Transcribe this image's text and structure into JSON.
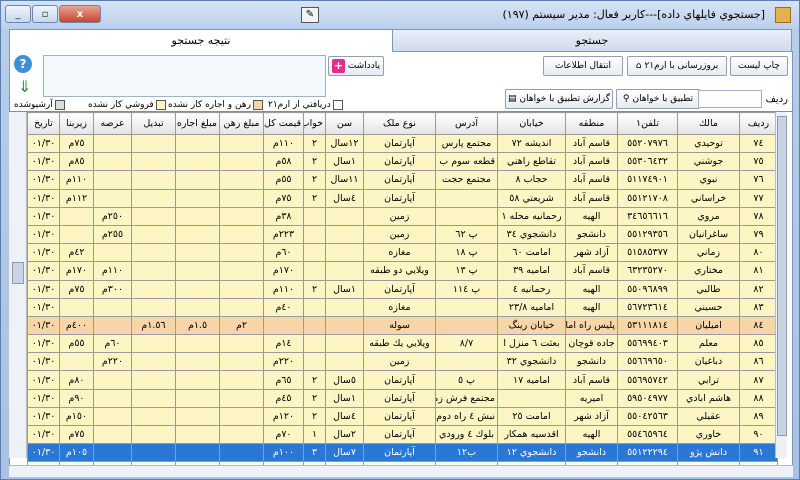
{
  "window": {
    "title": "[جستجوي فايلهاي داده]---كاربر فعال: مدير سيستم (١٩٧)",
    "buttons": {
      "minimize": "_",
      "maximize": "▫",
      "close": "x"
    }
  },
  "tabs": [
    {
      "label": "جستجو",
      "active": false
    },
    {
      "label": "نتيجه جستجو",
      "active": true
    }
  ],
  "toolbar": {
    "print_label": "چاپ ليست",
    "sms_label": "بروزرسانی با ارم٢١",
    "transfer_label": "انتقال اطلاعات",
    "note_label": "يادداشت",
    "match_label": "تطبيق با خواهان",
    "report_label": "گزارش تطبيق با خواهان",
    "row_search_label": "رديف",
    "row_search_value": ""
  },
  "legend": [
    {
      "label": "دريافتي از ارم٢١",
      "color": "#ffffff"
    },
    {
      "label": "رهن و اجاره كار نشده",
      "color": "#f6d6a8"
    },
    {
      "label": "فروشي كار نشده",
      "color": "#fdf6c4"
    },
    {
      "label": "آرشيوشده",
      "color": "#dcdcdc"
    }
  ],
  "colors": {
    "selected": "#2b77d6",
    "yellow_row": "#fdf6c4",
    "orange_row": "#f6d6a8"
  },
  "columns": [
    "رديف",
    "مالك",
    "تلفن١",
    "منطقه",
    "خيابان",
    "آدرس",
    "نوع ملک",
    "سن",
    "خواب",
    "قيمت كل",
    "مبلغ رهن",
    "مبلغ اجاره",
    "تبديل",
    "عرصه",
    "زيربنا",
    "تاريخ"
  ],
  "rows": [
    {
      "cls": "r-y",
      "cells": [
        "٧٤",
        "توحيدي",
        "٥٥٢٠٧٩٧٦",
        "قاسم آباد",
        "انديشه ٧٢",
        "مجتمع پارس",
        "آپارتمان",
        "١٢سال",
        "٢",
        "١١٠م",
        "",
        "",
        "",
        "",
        "٧٥م",
        "٠١/٣٠"
      ]
    },
    {
      "cls": "r-y",
      "cells": [
        "٧٥",
        "جوشني",
        "٥٥٣٠٦٤٣٢",
        "قاسم آباد",
        "تقاطع راهني",
        "قطعه سوم ب ٤٣",
        "آپارتمان",
        "١سال",
        "٢",
        "٥٨م",
        "",
        "",
        "",
        "",
        "٨٥م",
        "٠١/٣٠"
      ]
    },
    {
      "cls": "r-y",
      "cells": [
        "٧٦",
        "نبوي",
        "٥١١٧٤٩٠١",
        "قاسم آباد",
        "حجاب ٨",
        "مجتمع حجت",
        "آپارتمان",
        "١١سال",
        "٢",
        "٥٥م",
        "",
        "",
        "",
        "",
        "١١٠م",
        "٠١/٣٠"
      ]
    },
    {
      "cls": "r-y",
      "cells": [
        "٧٧",
        "خراساني",
        "٥٥١٢١٧٠٨",
        "قاسم آباد",
        "شريعتي ٥٨",
        "",
        "آپارتمان",
        "٤سال",
        "٢",
        "٧٥م",
        "",
        "",
        "",
        "",
        "١١٢م",
        "٠١/٣٠"
      ]
    },
    {
      "cls": "r-y",
      "cells": [
        "٧٨",
        "مروي",
        "٣٤٦٥٦٦١٦",
        "الهيه",
        "رحمانيه محله ١",
        "",
        "زمين",
        "",
        "",
        "٣٨م",
        "",
        "",
        "",
        "٢٥٠م",
        "",
        "٠١/٣٠"
      ]
    },
    {
      "cls": "r-y",
      "cells": [
        "٧٩",
        "ساغرانيان",
        "٥٥١٢٩٣٥٦",
        "دانشجو",
        "دانشجوي ٣٤",
        "پ ٦٢",
        "زمين",
        "",
        "",
        "٢٢٣م",
        "",
        "",
        "",
        "٢٥٥م",
        "",
        "٠١/٣٠"
      ]
    },
    {
      "cls": "r-y",
      "cells": [
        "٨٠",
        "زماني",
        "٥١٥٨٥٣٧٧",
        "آزاد شهر",
        "امامت ٦٠",
        "پ ١٨",
        "مغازه",
        "",
        "",
        "٦٠م",
        "",
        "",
        "",
        "",
        "٤٢م",
        "٠١/٣٠"
      ]
    },
    {
      "cls": "r-y",
      "cells": [
        "٨١",
        "مختاري",
        "٦٣٢٣٥٢٧٠",
        "قاسم آباد",
        "اماميه ٣٩",
        "پ ١٣",
        "ويلايي دو طبقه",
        "",
        "",
        "١٧٠م",
        "",
        "",
        "",
        "١١٠م",
        "١٧٠م",
        "٠١/٣٠"
      ]
    },
    {
      "cls": "r-y",
      "cells": [
        "٨٢",
        "طالبي",
        "٥٥٠٩٦٨٩٩",
        "الهيه",
        "رحمانيه ٤",
        "پ ١١٤",
        "آپارتمان",
        "١سال",
        "٢",
        "١١٠م",
        "",
        "",
        "",
        "٣٠٠م",
        "٧٥م",
        "٠١/٣٠"
      ]
    },
    {
      "cls": "r-y",
      "cells": [
        "٨٣",
        "حسيني",
        "٥٦٧٢٣٦١٤",
        "الهيه",
        "اماميه ٢٣/٨",
        "",
        "مغازه",
        "",
        "",
        "٤٠م",
        "",
        "",
        "",
        "",
        "",
        "٠١/٣٠"
      ]
    },
    {
      "cls": "r-o",
      "cells": [
        "٨٤",
        "اميليان",
        "٥٣١١١٨١٤",
        "پليس راه امام ه",
        "خيابان رينگ",
        "",
        "سوله",
        "",
        "",
        "",
        "٢م",
        "١.٥م",
        "١.٥٦م",
        "",
        "٤٠٠م",
        "٠١/٣٠"
      ]
    },
    {
      "cls": "r-y",
      "cells": [
        "٨٥",
        "معلم",
        "٥٥٦٩٩٤٠٣",
        "جاده قوچان",
        "بعثت ٦ منزل ا",
        "٨/٧",
        "ويلايي يك طبقه",
        "",
        "",
        "١٤م",
        "",
        "",
        "",
        "٦٠م",
        "٥٥م",
        "٠١/٣٠"
      ]
    },
    {
      "cls": "r-y",
      "cells": [
        "٨٦",
        "دباغيان",
        "٥٥٦٦٩٦٥٠",
        "دانشجو",
        "دانشجوي ٣٢",
        "",
        "زمين",
        "",
        "",
        "٢٢٠م",
        "",
        "",
        "",
        "٢٢٠م",
        "",
        "٠١/٣٠"
      ]
    },
    {
      "cls": "r-y",
      "cells": [
        "٨٧",
        "ترابي",
        "٥٥٦٩٥٧٤٢",
        "قاسم آباد",
        "اماميه ١٧",
        "پ ٥",
        "آپارتمان",
        "٥سال",
        "٢",
        "٦٥م",
        "",
        "",
        "",
        "",
        "٨٠م",
        "٠١/٣٠"
      ]
    },
    {
      "cls": "r-y",
      "cells": [
        "٨٨",
        "هاشم ابادي",
        "٥٩٥٠٤٩٧٧",
        "اميريه",
        "",
        "مجتمع فرش زمر",
        "آپارتمان",
        "١سال",
        "٢",
        "٤٥م",
        "",
        "",
        "",
        "",
        "٩٠م",
        "٠١/٣٠"
      ]
    },
    {
      "cls": "r-y",
      "cells": [
        "٨٩",
        "عقيلي",
        "٥٥٠٤٢٥٦٣",
        "آزاد شهر",
        "امامت ٢٥",
        "نبش ٤ راه دوم",
        "آپارتمان",
        "٤سال",
        "٢",
        "١٢٠م",
        "",
        "",
        "",
        "",
        "١٥٠م",
        "٠١/٣٠"
      ]
    },
    {
      "cls": "r-y",
      "cells": [
        "٩٠",
        "خاوري",
        "٥٥٤٦٥٩٦٤",
        "الهيه",
        "اقدسيه همكار",
        "بلوك ٤ ورودي",
        "آپارتمان",
        "٢سال",
        "١",
        "٧٠م",
        "",
        "",
        "",
        "",
        "٧٥م",
        "٠١/٣٠"
      ]
    },
    {
      "cls": "r-sel",
      "cells": [
        "٩١",
        "دانش پژو",
        "٥٥١٢٢٢٩٤",
        "دانشجو",
        "دانشجوي ١٢",
        "ب١٢",
        "آپارتمان",
        "٧سال",
        "٣",
        "١٠٠م",
        "",
        "",
        "",
        "",
        "١٠٥م",
        "٠١/٣٠"
      ]
    },
    {
      "cls": "r-w",
      "cells": [
        "",
        "",
        "",
        "",
        "",
        "",
        "",
        "",
        "",
        "",
        "",
        "",
        "",
        "",
        "",
        ""
      ]
    }
  ]
}
